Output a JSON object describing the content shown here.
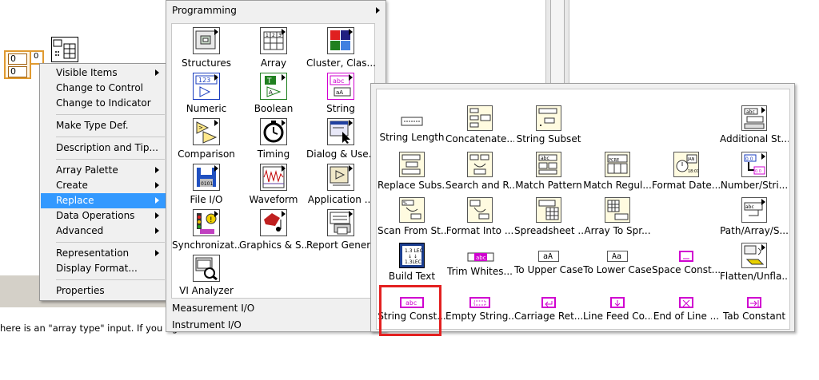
{
  "array_control": {
    "cell1": "0",
    "cell2": "0",
    "index": "0"
  },
  "bottom_text": "here is an \"array type\" input.  If you righ",
  "context_menu": {
    "items": [
      {
        "label": "Visible Items",
        "submenu": true
      },
      {
        "label": "Change to Control",
        "submenu": false
      },
      {
        "label": "Change to Indicator",
        "submenu": false
      },
      {
        "label": "Make Type Def.",
        "submenu": false
      },
      {
        "label": "Description and Tip...",
        "submenu": false
      },
      {
        "label": "Array Palette",
        "submenu": true
      },
      {
        "label": "Create",
        "submenu": true
      },
      {
        "label": "Replace",
        "submenu": true,
        "active": true
      },
      {
        "label": "Data Operations",
        "submenu": true
      },
      {
        "label": "Advanced",
        "submenu": true
      },
      {
        "label": "Representation",
        "submenu": true
      },
      {
        "label": "Display Format...",
        "submenu": false
      },
      {
        "label": "Properties",
        "submenu": false
      }
    ]
  },
  "programming_palette": {
    "title": "Programming",
    "items": [
      {
        "label": "Structures",
        "icon": "structures-icon"
      },
      {
        "label": "Array",
        "icon": "array-icon"
      },
      {
        "label": "Cluster, Clas...",
        "icon": "cluster-icon"
      },
      {
        "label": "Numeric",
        "icon": "numeric-icon"
      },
      {
        "label": "Boolean",
        "icon": "boolean-icon"
      },
      {
        "label": "String",
        "icon": "string-icon"
      },
      {
        "label": "Comparison",
        "icon": "comparison-icon"
      },
      {
        "label": "Timing",
        "icon": "timing-icon"
      },
      {
        "label": "Dialog & Use...",
        "icon": "dialog-icon"
      },
      {
        "label": "File I/O",
        "icon": "file-io-icon"
      },
      {
        "label": "Waveform",
        "icon": "waveform-icon"
      },
      {
        "label": "Application ...",
        "icon": "application-icon"
      },
      {
        "label": "Synchronizat...",
        "icon": "synchronization-icon"
      },
      {
        "label": "Graphics & S...",
        "icon": "graphics-sound-icon"
      },
      {
        "label": "Report Gener...",
        "icon": "report-generation-icon"
      },
      {
        "label": "VI Analyzer",
        "icon": "vi-analyzer-icon"
      }
    ],
    "bottom_items": [
      "Measurement I/O",
      "Instrument I/O"
    ]
  },
  "string_palette": {
    "items": [
      {
        "label": "String Length",
        "icon": "string-length-icon"
      },
      {
        "label": "Concatenate...",
        "icon": "concatenate-icon"
      },
      {
        "label": "String Subset",
        "icon": "string-subset-icon"
      },
      {
        "label": "Additional St...",
        "icon": "additional-string-icon"
      },
      {
        "label": "Replace Subs...",
        "icon": "replace-substring-icon"
      },
      {
        "label": "Search and R...",
        "icon": "search-replace-icon"
      },
      {
        "label": "Match Pattern",
        "icon": "match-pattern-icon"
      },
      {
        "label": "Match Regul...",
        "icon": "match-regex-icon"
      },
      {
        "label": "Format Date...",
        "icon": "format-date-icon"
      },
      {
        "label": "Number/Stri...",
        "icon": "number-string-icon"
      },
      {
        "label": "Scan From St...",
        "icon": "scan-from-string-icon"
      },
      {
        "label": "Format Into ...",
        "icon": "format-into-icon"
      },
      {
        "label": "Spreadsheet ...",
        "icon": "spreadsheet-icon"
      },
      {
        "label": "Array To Spr...",
        "icon": "array-to-spreadsheet-icon"
      },
      {
        "label": "Path/Array/S...",
        "icon": "path-array-icon"
      },
      {
        "label": "Build Text",
        "icon": "build-text-icon"
      },
      {
        "label": "Trim Whites...",
        "icon": "trim-whitespace-icon"
      },
      {
        "label": "To Upper Case",
        "icon": "to-upper-case-icon"
      },
      {
        "label": "To Lower Case",
        "icon": "to-lower-case-icon"
      },
      {
        "label": "Space Const...",
        "icon": "space-constant-icon"
      },
      {
        "label": "Flatten/Unfla...",
        "icon": "flatten-icon"
      },
      {
        "label": "String Const...",
        "icon": "string-constant-icon"
      },
      {
        "label": "Empty String...",
        "icon": "empty-string-icon"
      },
      {
        "label": "Carriage Ret...",
        "icon": "carriage-return-icon"
      },
      {
        "label": "Line Feed Co...",
        "icon": "line-feed-icon"
      },
      {
        "label": "End of Line ...",
        "icon": "end-of-line-icon"
      },
      {
        "label": "Tab Constant",
        "icon": "tab-constant-icon"
      }
    ],
    "glyphs": {
      "abc": "abc",
      "aA": "aA",
      "Aa": "Aa"
    }
  },
  "colors": {
    "highlight": "#e32020",
    "selected": "#3399ff",
    "string_pink": "#d000d0"
  }
}
